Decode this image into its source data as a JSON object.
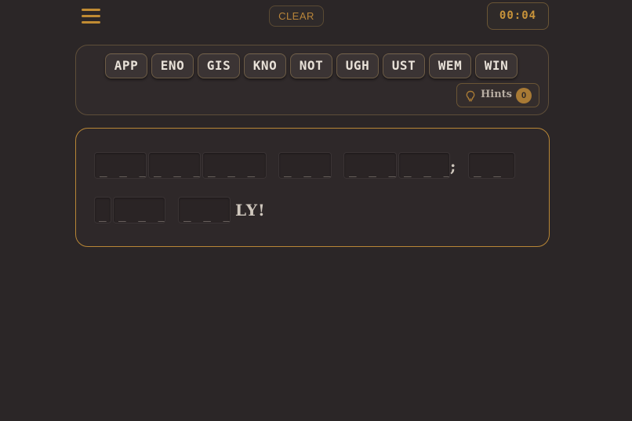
{
  "header": {
    "clear_label": "CLEAR",
    "timer": "00:04",
    "menu_icon": "hamburger-menu-icon"
  },
  "tray": {
    "tiles": [
      "APP",
      "ENO",
      "GIS",
      "KNO",
      "NOT",
      "UGH",
      "UST",
      "WEM",
      "WIN"
    ],
    "hints": {
      "label": "Hints",
      "count": "0",
      "icon": "lightbulb-icon"
    }
  },
  "board": {
    "row1": {
      "slot1": "_ _ _",
      "slot2": "_ _ _",
      "slot3": "_  _ _",
      "slot4": "_ _ _",
      "slot5": "_ _ _",
      "slot6": "_ _ _",
      "punct": ";",
      "slot7": "_ _"
    },
    "row2": {
      "slot1": "_",
      "slot2": "_ _ _",
      "slot3": "_ _ _",
      "fixed": "LY!"
    }
  },
  "colors": {
    "background": "#2b2627",
    "accent": "#c08b33",
    "tile_bg": "#3b3434",
    "text": "#e8e1d8"
  }
}
